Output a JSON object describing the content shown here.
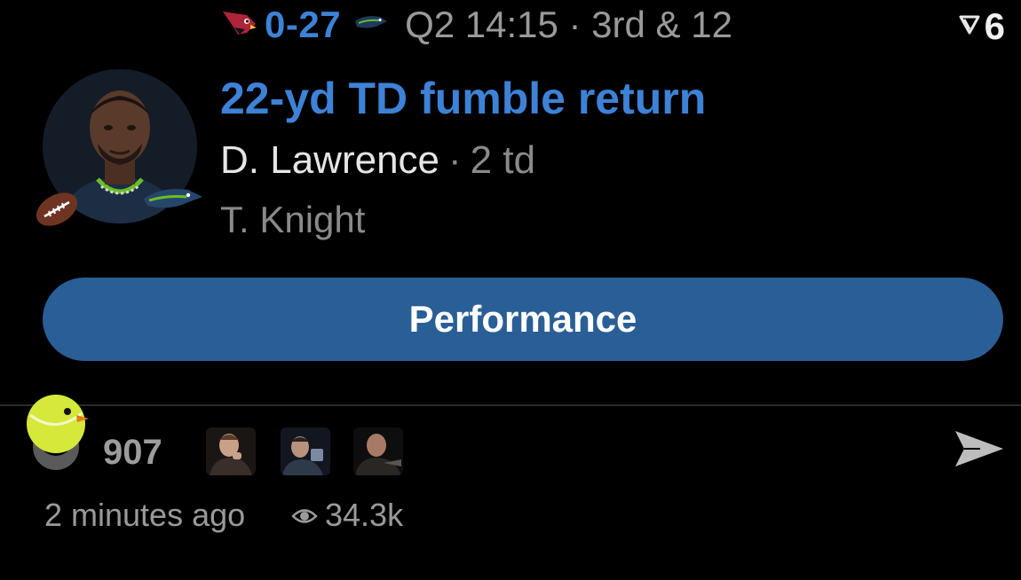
{
  "scorebar": {
    "away_logo": "cardinals-logo-icon",
    "score": "0-27",
    "home_logo": "seahawks-logo-icon",
    "game_clock": "Q2 14:15 · 3rd & 12",
    "corner_icon": "reaction-count-icon",
    "corner_count": "6"
  },
  "play": {
    "avatar": "player-photo-avatar",
    "title": "22-yd TD fumble return",
    "player": "D. Lawrence",
    "separator": "·",
    "player_stat": "2 td",
    "secondary_player": "T. Knight"
  },
  "button": {
    "label": "Performance"
  },
  "engagement": {
    "reaction_icon": "tennis-ball-bird-icon",
    "reaction_count": "907",
    "reactors": [
      "reactor-avatar-1",
      "reactor-avatar-2",
      "reactor-avatar-3"
    ],
    "share_icon": "send-icon",
    "timestamp": "2 minutes ago",
    "views_icon": "eye-icon",
    "views": "34.3k"
  },
  "colors": {
    "accent_blue": "#3d82d6",
    "button_blue": "#2a5e96",
    "muted_gray": "#8a8a8a",
    "background": "#000000"
  }
}
